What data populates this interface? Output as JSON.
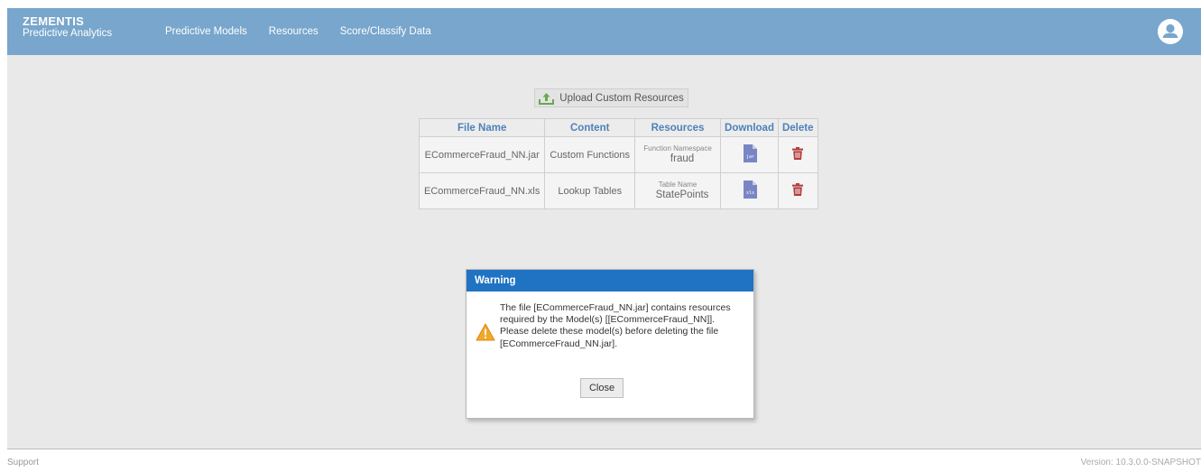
{
  "header": {
    "brand_title": "ZEMENTIS",
    "brand_subtitle": "Predictive Analytics",
    "nav": [
      "Predictive Models",
      "Resources",
      "Score/Classify Data"
    ],
    "color": "#78a6cc"
  },
  "upload": {
    "label": "Upload Custom Resources"
  },
  "table": {
    "headers": [
      "File Name",
      "Content",
      "Resources",
      "Download",
      "Delete"
    ],
    "rows": [
      {
        "file_name": "ECommerceFraud_NN.jar",
        "content": "Custom Functions",
        "resource_label": "Function Namespace",
        "resource_value": "fraud",
        "download_type": "jar"
      },
      {
        "file_name": "ECommerceFraud_NN.xls",
        "content": "Lookup Tables",
        "resource_label": "Table Name",
        "resource_value": "StatePoints",
        "download_type": "xls"
      }
    ]
  },
  "dialog": {
    "title": "Warning",
    "message": "The file [ECommerceFraud_NN.jar] contains resources required by the Model(s) [[ECommerceFraud_NN]]. Please delete these model(s) before deleting the file [ECommerceFraud_NN.jar].",
    "close_label": "Close",
    "header_color": "#1f73c2"
  },
  "footer": {
    "support": "Support",
    "version": "Version: 10.3.0.0-SNAPSHOT"
  },
  "icons": {
    "user": "user-avatar-icon",
    "upload": "upload-icon",
    "file_download": "file-download-icon",
    "delete": "trash-icon",
    "warning": "warning-icon"
  }
}
